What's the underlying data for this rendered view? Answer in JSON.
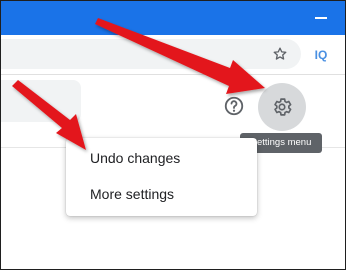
{
  "toolbar": {
    "extension_label": "IQ"
  },
  "tooltip": {
    "text": "Settings menu"
  },
  "menu": {
    "items": [
      {
        "label": "Undo changes"
      },
      {
        "label": "More settings"
      }
    ]
  },
  "colors": {
    "titlebar": "#1a73e8",
    "arrow": "#e3191c",
    "tooltip": "#5f6368",
    "gear_button": "#d7d9db"
  },
  "icons": [
    "minimize-icon",
    "star-icon",
    "help-icon",
    "gear-icon"
  ]
}
